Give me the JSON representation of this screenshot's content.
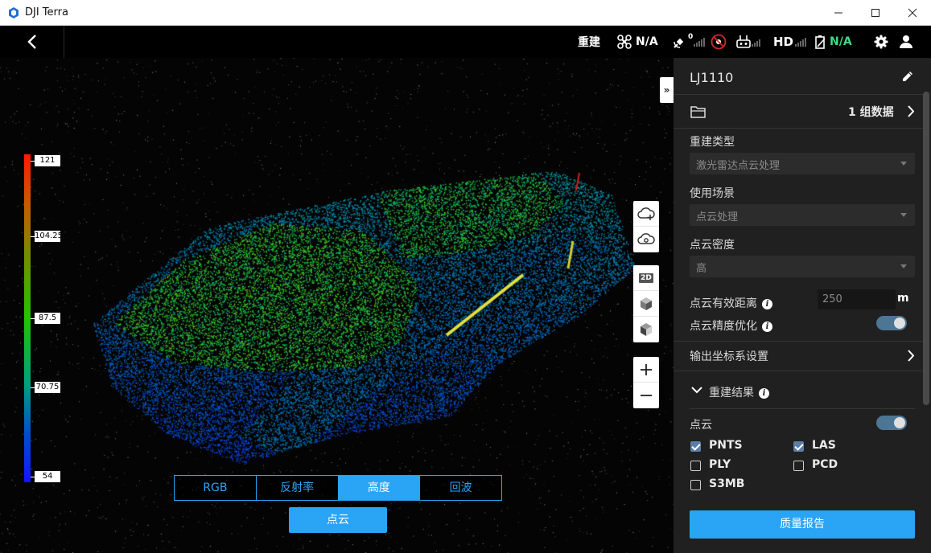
{
  "window": {
    "title": "DJI Terra"
  },
  "toolbar": {
    "rebuild_label": "重建",
    "drone_status": "N/A",
    "gps_count": "0",
    "hd_label": "HD",
    "battery_status": "N/A"
  },
  "viewport": {
    "legend": [
      "121",
      "104.25",
      "87.5",
      "70.75",
      "54"
    ],
    "tool_2d_label": "2D",
    "collapse_label": "»",
    "modes": [
      {
        "label": "RGB",
        "active": false
      },
      {
        "label": "反射率",
        "active": false
      },
      {
        "label": "高度",
        "active": true
      },
      {
        "label": "回波",
        "active": false
      }
    ],
    "pointcloud_button": "点云"
  },
  "panel": {
    "project_name": "LJ1110",
    "data_groups": "1 组数据",
    "recon_type_label": "重建类型",
    "recon_type_value": "激光雷达点云处理",
    "scene_label": "使用场景",
    "scene_value": "点云处理",
    "density_label": "点云密度",
    "density_value": "高",
    "effective_distance_label": "点云有效距离",
    "effective_distance_value": "250",
    "effective_distance_unit": "m",
    "precision_label": "点云精度优化",
    "precision_enabled": true,
    "coord_label": "输出坐标系设置",
    "results_label": "重建结果",
    "pointcloud_label": "点云",
    "pointcloud_enabled": true,
    "formats": [
      {
        "label": "PNTS",
        "checked": true
      },
      {
        "label": "LAS",
        "checked": true
      },
      {
        "label": "PLY",
        "checked": false
      },
      {
        "label": "PCD",
        "checked": false
      },
      {
        "label": "S3MB",
        "checked": false
      }
    ],
    "report_button": "质量报告"
  },
  "colors": {
    "accent": "#2aa4f4",
    "panel_bg": "#202020",
    "toggle_on": "#4d7594",
    "status_green": "#3ddc84"
  }
}
